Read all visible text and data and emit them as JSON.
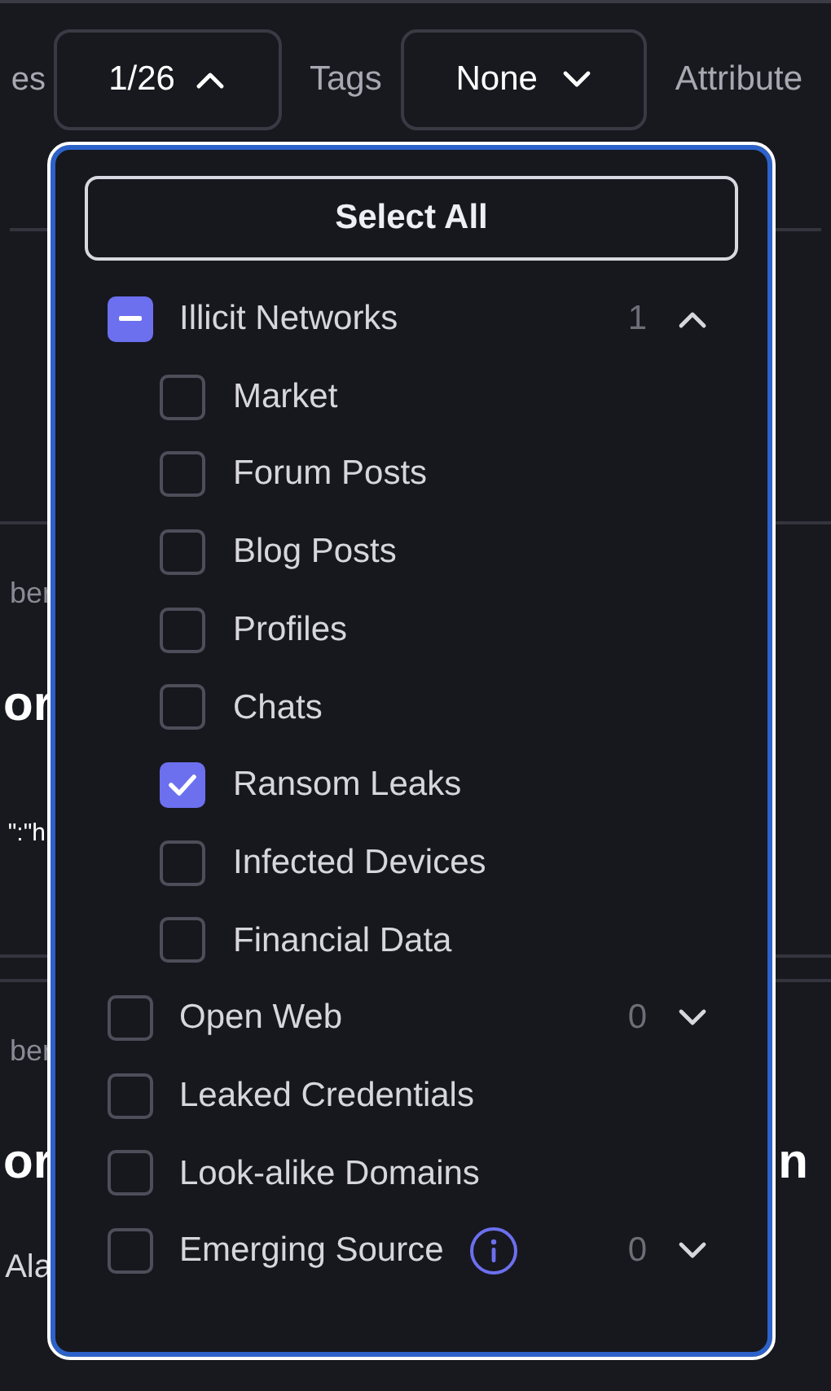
{
  "filter_bar": {
    "label_1": "es",
    "sources_button": {
      "value": "1/26",
      "expanded": true
    },
    "tags_label": "Tags",
    "tags_button": {
      "value": "None",
      "expanded": false
    },
    "label_3": "Attribute"
  },
  "background": {
    "left_texts": [
      {
        "kind": "small",
        "text": "ber"
      },
      {
        "kind": "heading",
        "text": "or"
      },
      {
        "kind": "code",
        "text": "\":\"h"
      },
      {
        "kind": "small",
        "text": "ber"
      },
      {
        "kind": "heading",
        "text": "or"
      },
      {
        "kind": "body",
        "text": "Ala"
      }
    ],
    "right_heading": "n"
  },
  "dropdown": {
    "select_all": "Select All",
    "items": [
      {
        "label": "Illicit Networks",
        "checked": false,
        "indeterminate": true,
        "count": "1",
        "expanded": true,
        "info": false,
        "children": [
          {
            "label": "Market",
            "checked": false
          },
          {
            "label": "Forum Posts",
            "checked": false
          },
          {
            "label": "Blog Posts",
            "checked": false
          },
          {
            "label": "Profiles",
            "checked": false
          },
          {
            "label": "Chats",
            "checked": false
          },
          {
            "label": "Ransom Leaks",
            "checked": true
          },
          {
            "label": "Infected Devices",
            "checked": false
          },
          {
            "label": "Financial Data",
            "checked": false
          }
        ]
      },
      {
        "label": "Open Web",
        "checked": false,
        "indeterminate": false,
        "count": "0",
        "expanded": false,
        "info": false
      },
      {
        "label": "Leaked Credentials",
        "checked": false,
        "indeterminate": false,
        "info": false
      },
      {
        "label": "Look-alike Domains",
        "checked": false,
        "indeterminate": false,
        "info": false
      },
      {
        "label": "Emerging Source",
        "checked": false,
        "indeterminate": false,
        "count": "0",
        "expanded": false,
        "info": true
      }
    ]
  }
}
